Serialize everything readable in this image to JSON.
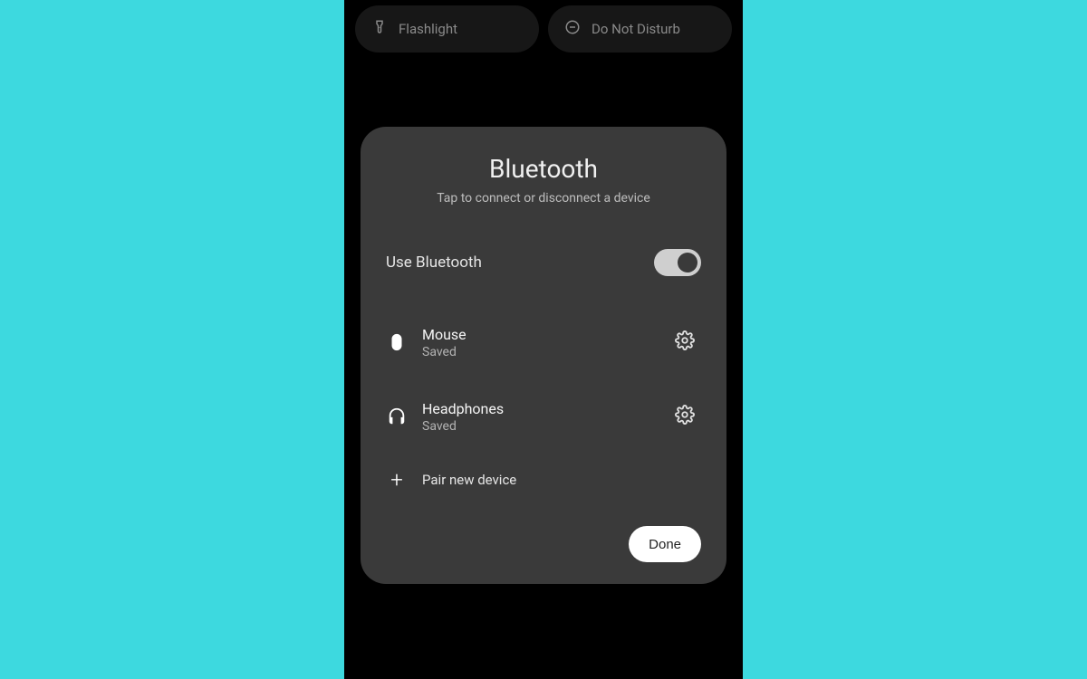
{
  "qs": {
    "tiles": [
      {
        "label": "Flashlight"
      },
      {
        "label": "Do Not Disturb"
      }
    ]
  },
  "bluetooth_panel": {
    "title": "Bluetooth",
    "subtitle": "Tap to connect or disconnect a device",
    "toggle_label": "Use Bluetooth",
    "devices": [
      {
        "name": "Mouse",
        "status": "Saved"
      },
      {
        "name": "Headphones",
        "status": "Saved"
      }
    ],
    "pair_label": "Pair new device",
    "done_label": "Done"
  }
}
